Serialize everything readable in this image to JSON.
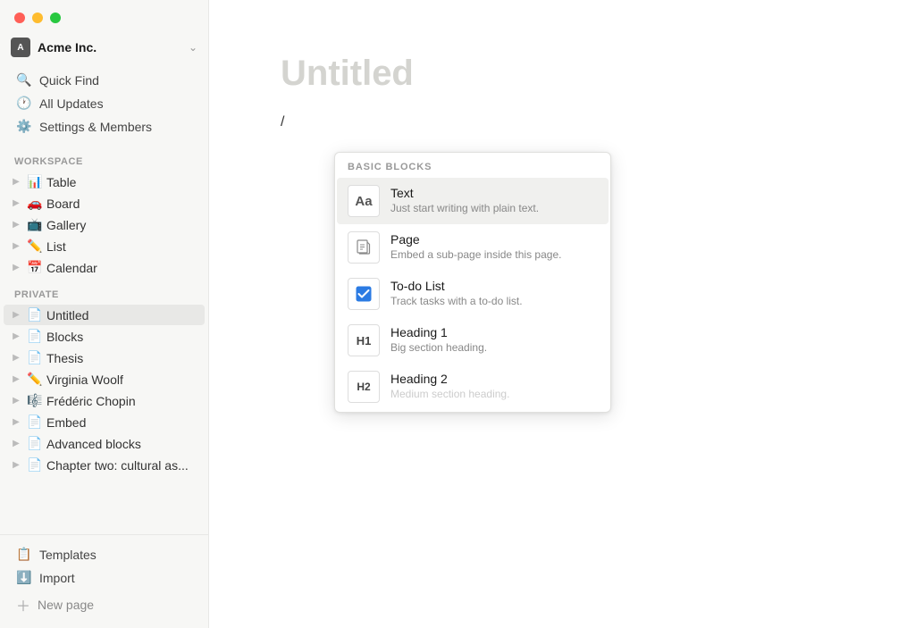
{
  "titlebar": {
    "traffic_lights": [
      "red",
      "yellow",
      "green"
    ]
  },
  "sidebar": {
    "workspace": {
      "name": "Acme Inc.",
      "chevron": "⌄"
    },
    "nav": [
      {
        "id": "quick-find",
        "icon": "🔍",
        "label": "Quick Find"
      },
      {
        "id": "all-updates",
        "icon": "🕐",
        "label": "All Updates"
      },
      {
        "id": "settings",
        "icon": "⚙️",
        "label": "Settings & Members"
      }
    ],
    "workspace_section": "WORKSPACE",
    "workspace_pages": [
      {
        "id": "table",
        "emoji": "📊",
        "label": "Table"
      },
      {
        "id": "board",
        "emoji": "🚗",
        "label": "Board"
      },
      {
        "id": "gallery",
        "emoji": "📺",
        "label": "Gallery"
      },
      {
        "id": "list",
        "emoji": "✏️",
        "label": "List"
      },
      {
        "id": "calendar",
        "emoji": "📅",
        "label": "Calendar"
      }
    ],
    "private_section": "PRIVATE",
    "private_pages": [
      {
        "id": "untitled",
        "emoji": "📄",
        "label": "Untitled",
        "active": true
      },
      {
        "id": "blocks",
        "emoji": "📄",
        "label": "Blocks",
        "active": false
      },
      {
        "id": "thesis",
        "emoji": "📄",
        "label": "Thesis",
        "active": false
      },
      {
        "id": "virginia-woolf",
        "emoji": "✏️",
        "label": "Virginia Woolf",
        "active": false
      },
      {
        "id": "frederic-chopin",
        "emoji": "🎼",
        "label": "Frédéric Chopin",
        "active": false
      },
      {
        "id": "embed",
        "emoji": "📄",
        "label": "Embed",
        "active": false
      },
      {
        "id": "advanced-blocks",
        "emoji": "📄",
        "label": "Advanced blocks",
        "active": false
      },
      {
        "id": "chapter-two",
        "emoji": "📄",
        "label": "Chapter two: cultural as...",
        "active": false
      }
    ],
    "bottom_nav": [
      {
        "id": "templates",
        "icon": "📋",
        "label": "Templates"
      },
      {
        "id": "import",
        "icon": "⬇️",
        "label": "Import"
      }
    ],
    "new_page": "New page"
  },
  "editor": {
    "title_placeholder": "Untitled",
    "slash_char": "/"
  },
  "dropdown": {
    "section_label": "BASIC BLOCKS",
    "items": [
      {
        "id": "text",
        "title": "Text",
        "description": "Just start writing with plain text.",
        "icon_type": "text",
        "icon_display": "Aa",
        "selected": true
      },
      {
        "id": "page",
        "title": "Page",
        "description": "Embed a sub-page inside this page.",
        "icon_type": "page",
        "icon_display": "📄",
        "selected": false
      },
      {
        "id": "todo-list",
        "title": "To-do List",
        "description": "Track tasks with a to-do list.",
        "icon_type": "checkbox",
        "icon_display": "☑",
        "selected": false
      },
      {
        "id": "heading1",
        "title": "Heading 1",
        "description": "Big section heading.",
        "icon_type": "h1",
        "icon_display": "H1",
        "selected": false
      },
      {
        "id": "heading2",
        "title": "Heading 2",
        "description": "Medium section heading.",
        "icon_type": "h2",
        "icon_display": "H2",
        "selected": false
      }
    ]
  }
}
